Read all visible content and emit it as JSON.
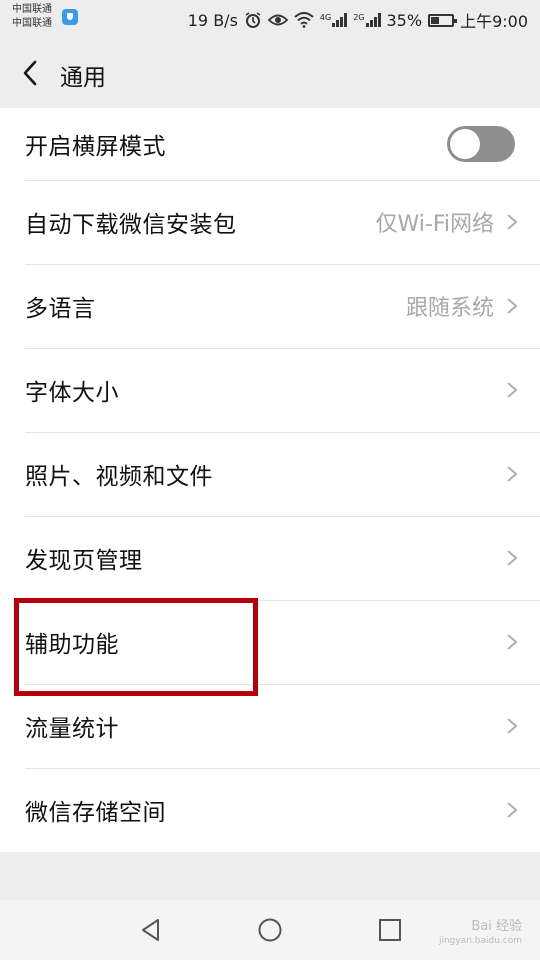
{
  "status_bar": {
    "carrier1": "中国联通",
    "carrier2": "中国联通",
    "net_speed": "19 B/s",
    "net1": "4G",
    "net2": "2G",
    "battery": "35%",
    "time": "上午9:00"
  },
  "header": {
    "title": "通用"
  },
  "settings": [
    {
      "label": "开启横屏模式",
      "value": "",
      "toggle": false
    },
    {
      "label": "自动下载微信安装包",
      "value": "仅Wi-Fi网络"
    },
    {
      "label": "多语言",
      "value": "跟随系统"
    },
    {
      "label": "字体大小",
      "value": ""
    },
    {
      "label": "照片、视频和文件",
      "value": ""
    },
    {
      "label": "发现页管理",
      "value": ""
    },
    {
      "label": "辅助功能",
      "value": ""
    },
    {
      "label": "流量统计",
      "value": ""
    },
    {
      "label": "微信存储空间",
      "value": ""
    }
  ],
  "watermark": "Bai 经验",
  "watermark_url": "jingyan.baidu.com",
  "colors": {
    "accent_highlight": "#b4000b",
    "toggle_off": "#8e8e8e",
    "background": "#ededed"
  },
  "icons": {
    "back": "back-chevron-icon",
    "row_arrow": "chevron-right-icon",
    "nav_back": "triangle-back-icon",
    "nav_home": "circle-home-icon",
    "nav_recents": "square-recents-icon"
  }
}
